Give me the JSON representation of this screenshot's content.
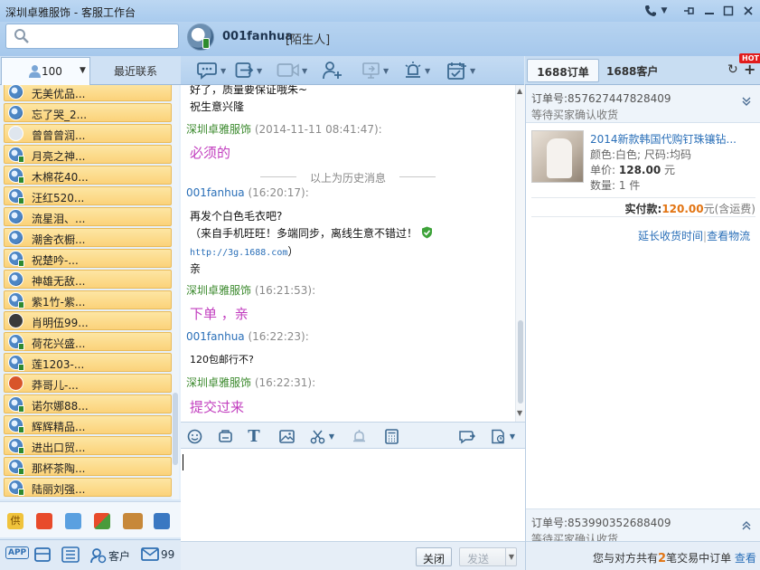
{
  "window": {
    "title": "深圳卓雅服饰 - 客服工作台"
  },
  "chat_header": {
    "contact_name": "001fanhua",
    "contact_tag": "[陌生人]"
  },
  "left_tabs": {
    "contacts_count": "100",
    "recent": "最近联系"
  },
  "right_tabs": {
    "orders": "1688订单",
    "customers": "1688客户",
    "hot": "HOT"
  },
  "contacts": [
    {
      "name": "无美优品...",
      "avatar": "blue"
    },
    {
      "name": "忘了哭_2...",
      "avatar": "blue"
    },
    {
      "name": "曾曾曾润...",
      "avatar": "photo"
    },
    {
      "name": "月亮之神...",
      "avatar": "blue"
    },
    {
      "name": "木棉花40...",
      "avatar": "blue"
    },
    {
      "name": "汪红520...",
      "avatar": "blue"
    },
    {
      "name": "流星泪、...",
      "avatar": "blue"
    },
    {
      "name": "潮舍衣橱...",
      "avatar": "blue"
    },
    {
      "name": "祝楚吟-...",
      "avatar": "blue"
    },
    {
      "name": "神雄无敌...",
      "avatar": "blue"
    },
    {
      "name": "紫1竹-紫...",
      "avatar": "blue"
    },
    {
      "name": "肖明伍99...",
      "avatar": "photo"
    },
    {
      "name": "荷花兴盛...",
      "avatar": "blue"
    },
    {
      "name": "莲1203-...",
      "avatar": "blue"
    },
    {
      "name": "莽哥儿-...",
      "avatar": "photo"
    },
    {
      "name": "诺尔娜88...",
      "avatar": "blue"
    },
    {
      "name": "辉辉精品...",
      "avatar": "blue"
    },
    {
      "name": "进出口贸...",
      "avatar": "blue"
    },
    {
      "name": "那杯茶陶...",
      "avatar": "blue"
    },
    {
      "name": "陆丽刘强...",
      "avatar": "blue"
    }
  ],
  "bottom_left": {
    "app": "APP",
    "customers": "客户",
    "mail_count": "99"
  },
  "chat": {
    "top_partial_1": "好了，质量要保证哦朱~",
    "top_partial_2": "祝生意兴隆",
    "m1_sender": "深圳卓雅服饰",
    "m1_time": "(2014-11-11 08:41:47):",
    "m1_text": "必须的",
    "history_sep": "以上为历史消息",
    "m2_sender": "001fanhua",
    "m2_time": "(16:20:17):",
    "m2_text1": "再发个白色毛衣吧?",
    "m2_text2": "（来自手机旺旺！多端同步，离线生意不错过！",
    "m2_link": "http://3g.1688.com",
    "m2_link_close": "）",
    "m2_text3": "亲",
    "m3_sender": "深圳卓雅服饰",
    "m3_time": "(16:21:53):",
    "m3_text": "下单 ，亲",
    "m4_sender": "001fanhua",
    "m4_time": "(16:22:23):",
    "m4_text": "120包邮行不?",
    "m5_sender": "深圳卓雅服饰",
    "m5_time": "(16:22:31):",
    "m5_text": "提交过来"
  },
  "send_row": {
    "close": "关闭",
    "send": "发送"
  },
  "order1": {
    "number": "订单号:857627447828409",
    "status": "等待买家确认收货",
    "title": "2014新款韩国代购钉珠镶钻...",
    "color_label": "颜色:",
    "color": "白色;",
    "size_label": "尺码:",
    "size": "均码",
    "price_label": "单价:",
    "price": "128.00",
    "price_unit": "元",
    "qty_label": "数量:",
    "qty": "1",
    "qty_unit": "件",
    "paid_label": "实付款:",
    "paid": "120.00",
    "paid_suffix": "元(含运费)",
    "action1": "延长收货时间",
    "action2": "查看物流"
  },
  "order2": {
    "number": "订单号:853990352688409",
    "status": "等待买家确认收货"
  },
  "right_footer": {
    "prefix": "您与对方共有",
    "count": "2",
    "suffix": "笔交易中订单",
    "view": "查看"
  }
}
